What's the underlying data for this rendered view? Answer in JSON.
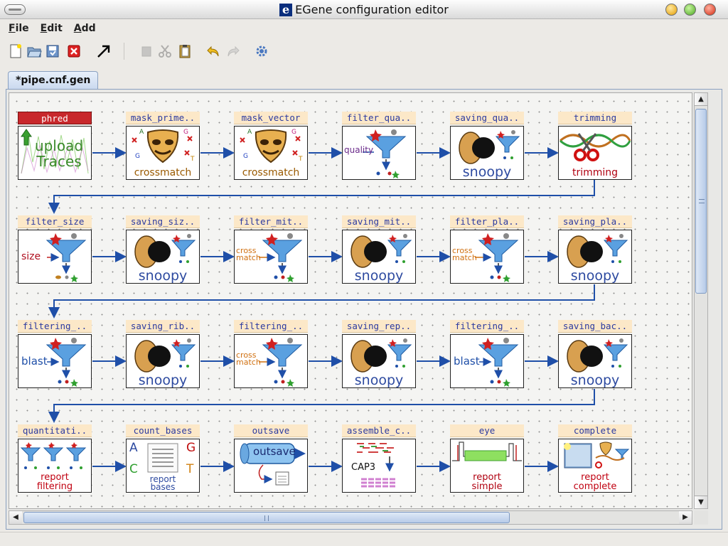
{
  "window": {
    "app_icon_letter": "e",
    "title": "EGene configuration editor"
  },
  "menu": [
    {
      "label": "File",
      "mnemonic": "F",
      "rest": "ile"
    },
    {
      "label": "Edit",
      "mnemonic": "E",
      "rest": "dit"
    },
    {
      "label": "Add",
      "mnemonic": "A",
      "rest": "dd"
    }
  ],
  "toolbar": {
    "icons": [
      "new-file-icon",
      "open-folder-icon",
      "save-icon",
      "close-icon",
      "select-arrow-icon",
      "copy-icon",
      "cut-icon",
      "paste-icon",
      "undo-icon",
      "redo-icon",
      "settings-icon"
    ],
    "disabled": [
      "copy-icon",
      "cut-icon",
      "redo-icon"
    ]
  },
  "tab": {
    "label": "*pipe.cnf.gen"
  },
  "colors": {
    "connector": "#1f4fa8",
    "label_bg": "#fce8c8",
    "label_text": "#2b3aa0",
    "first_label_bg": "#c8282c"
  },
  "nodes": [
    {
      "label": "phred",
      "caption": "upload\nTraces",
      "icon": "upload-traces-icon"
    },
    {
      "label": "mask_prime..",
      "caption": "crossmatch",
      "icon": "crossmatch-mask-icon"
    },
    {
      "label": "mask_vector",
      "caption": "crossmatch",
      "icon": "crossmatch-mask-icon"
    },
    {
      "label": "filter_qua..",
      "caption": "quality",
      "icon": "filter-funnel-icon"
    },
    {
      "label": "saving_qua..",
      "caption": "snoopy",
      "icon": "snoopy-icon"
    },
    {
      "label": "trimming",
      "caption": "trimming",
      "icon": "trimming-scissors-icon"
    },
    {
      "label": "filter_size",
      "caption": "size",
      "icon": "filter-funnel-icon"
    },
    {
      "label": "saving_siz..",
      "caption": "snoopy",
      "icon": "snoopy-icon"
    },
    {
      "label": "filter_mit..",
      "caption": "cross\nmatch",
      "icon": "filter-funnel-icon"
    },
    {
      "label": "saving_mit..",
      "caption": "snoopy",
      "icon": "snoopy-icon"
    },
    {
      "label": "filter_pla..",
      "caption": "cross\nmatch",
      "icon": "filter-funnel-icon"
    },
    {
      "label": "saving_pla..",
      "caption": "snoopy",
      "icon": "snoopy-icon"
    },
    {
      "label": "filtering_..",
      "caption": "blast",
      "icon": "filter-funnel-icon"
    },
    {
      "label": "saving_rib..",
      "caption": "snoopy",
      "icon": "snoopy-icon"
    },
    {
      "label": "filtering_..",
      "caption": "cross\nmatch",
      "icon": "filter-funnel-icon"
    },
    {
      "label": "saving_rep..",
      "caption": "snoopy",
      "icon": "snoopy-icon"
    },
    {
      "label": "filtering_..",
      "caption": "blast",
      "icon": "filter-funnel-icon"
    },
    {
      "label": "saving_bac..",
      "caption": "snoopy",
      "icon": "snoopy-icon"
    },
    {
      "label": "quantitati..",
      "caption": "report\nfiltering",
      "icon": "report-filtering-icon"
    },
    {
      "label": "count_bases",
      "caption": "report\nbases",
      "icon": "count-bases-icon"
    },
    {
      "label": "outsave",
      "caption": "outsave",
      "icon": "outsave-icon"
    },
    {
      "label": "assemble_c..",
      "caption": "CAP3",
      "icon": "cap3-assembly-icon"
    },
    {
      "label": "eye",
      "caption": "report\nsimple",
      "icon": "eye-report-icon"
    },
    {
      "label": "complete",
      "caption": "report\ncomplete",
      "icon": "report-complete-icon"
    }
  ],
  "count_bases_letters": [
    "A",
    "G",
    "C",
    "T"
  ]
}
